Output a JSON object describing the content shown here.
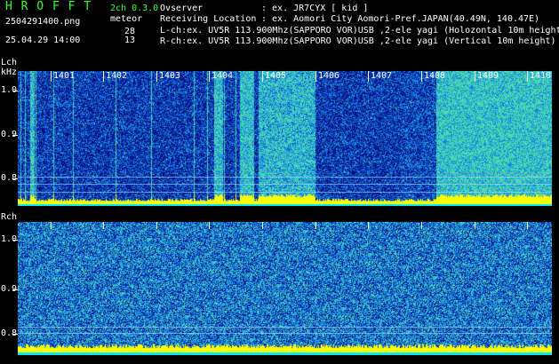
{
  "app": {
    "title": "H R O F F T",
    "version": "2ch 0.3.0",
    "mode": "meteor",
    "file": "2504291400.png",
    "datetime": "25.04.29 14:00",
    "count_l": "28",
    "count_r": "13"
  },
  "info": {
    "observer_label": "Ovserver",
    "observer_value": ": ex. JR7CYX [ kid ]",
    "location_label": "Receiving Location",
    "location_value": ": ex. Aomori City Aomori-Pref.JAPAN(40.49N, 140.47E)",
    "lch_line": "L-ch:ex. UV5R 113.900Mhz(SAPPORO VOR)USB ,2-ele yagi (Holozontal 10m height)",
    "rch_line": "R-ch:ex. UV5R 113.900Mhz(SAPPORO VOR)USB ,2-ele yagi (Vertical 10m height)"
  },
  "panels": {
    "lch_label": "Lch",
    "khz_label": "kHz",
    "rch_label": "Rch",
    "y_ticks": [
      "1.0",
      "0.9",
      "0.8"
    ],
    "time_labels": [
      "1401",
      "1402",
      "1403",
      "1404",
      "1405",
      "1406",
      "1407",
      "1408",
      "1409",
      "1410"
    ]
  },
  "colors": {
    "background": "#000000",
    "header_green": "#33ff33",
    "signal_yellow": "#ffff00",
    "floor_cyan": "#00e5ff",
    "noise_low": "#0a1a8c",
    "noise_high": "#30c8a0"
  }
}
